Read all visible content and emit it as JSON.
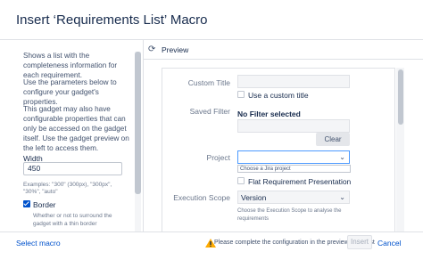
{
  "dialog": {
    "title": "Insert ‘Requirements List’ Macro"
  },
  "sidebar": {
    "description": "Shows a list with the completeness information for each requirement.",
    "params_hint": "Use the parameters below to configure your gadget's properties.",
    "config_hint": "This gadget may also have configurable properties that can only be accessed on the gadget itself. Use the gadget preview on the left to access them.",
    "width_label": "Width",
    "width_value": "450",
    "width_examples": "Examples: \"300\" (300px), \"300px\", \"30%\", \"auto\"",
    "border_label": "Border",
    "border_checked": true,
    "border_help": "Whether or not to surround the gadget with a thin border"
  },
  "preview": {
    "label": "Preview",
    "custom_title_label": "Custom Title",
    "custom_title_value": "",
    "use_custom_title_label": "Use a custom title",
    "saved_filter_label": "Saved Filter",
    "saved_filter_value": "No Filter selected",
    "clear_label": "Clear",
    "project_label": "Project",
    "project_value": "",
    "project_hint": "Choose a Jira project",
    "flat_label": "Flat Requirement Presentation",
    "execution_scope_label": "Execution Scope",
    "execution_scope_value": "Version",
    "execution_scope_help": "Choose the Execution Scope to analyse the requirements"
  },
  "footer": {
    "select_macro": "Select macro",
    "warning": "Please complete the configuration in the preview area first",
    "insert": "Insert",
    "cancel": "Cancel"
  },
  "colors": {
    "link": "#0052cc",
    "accent": "#0052cc",
    "focus": "#4c9aff",
    "warning": "#ffab00"
  },
  "icons": [
    "refresh-icon",
    "chevron-down-icon",
    "warning-icon",
    "check-icon"
  ]
}
